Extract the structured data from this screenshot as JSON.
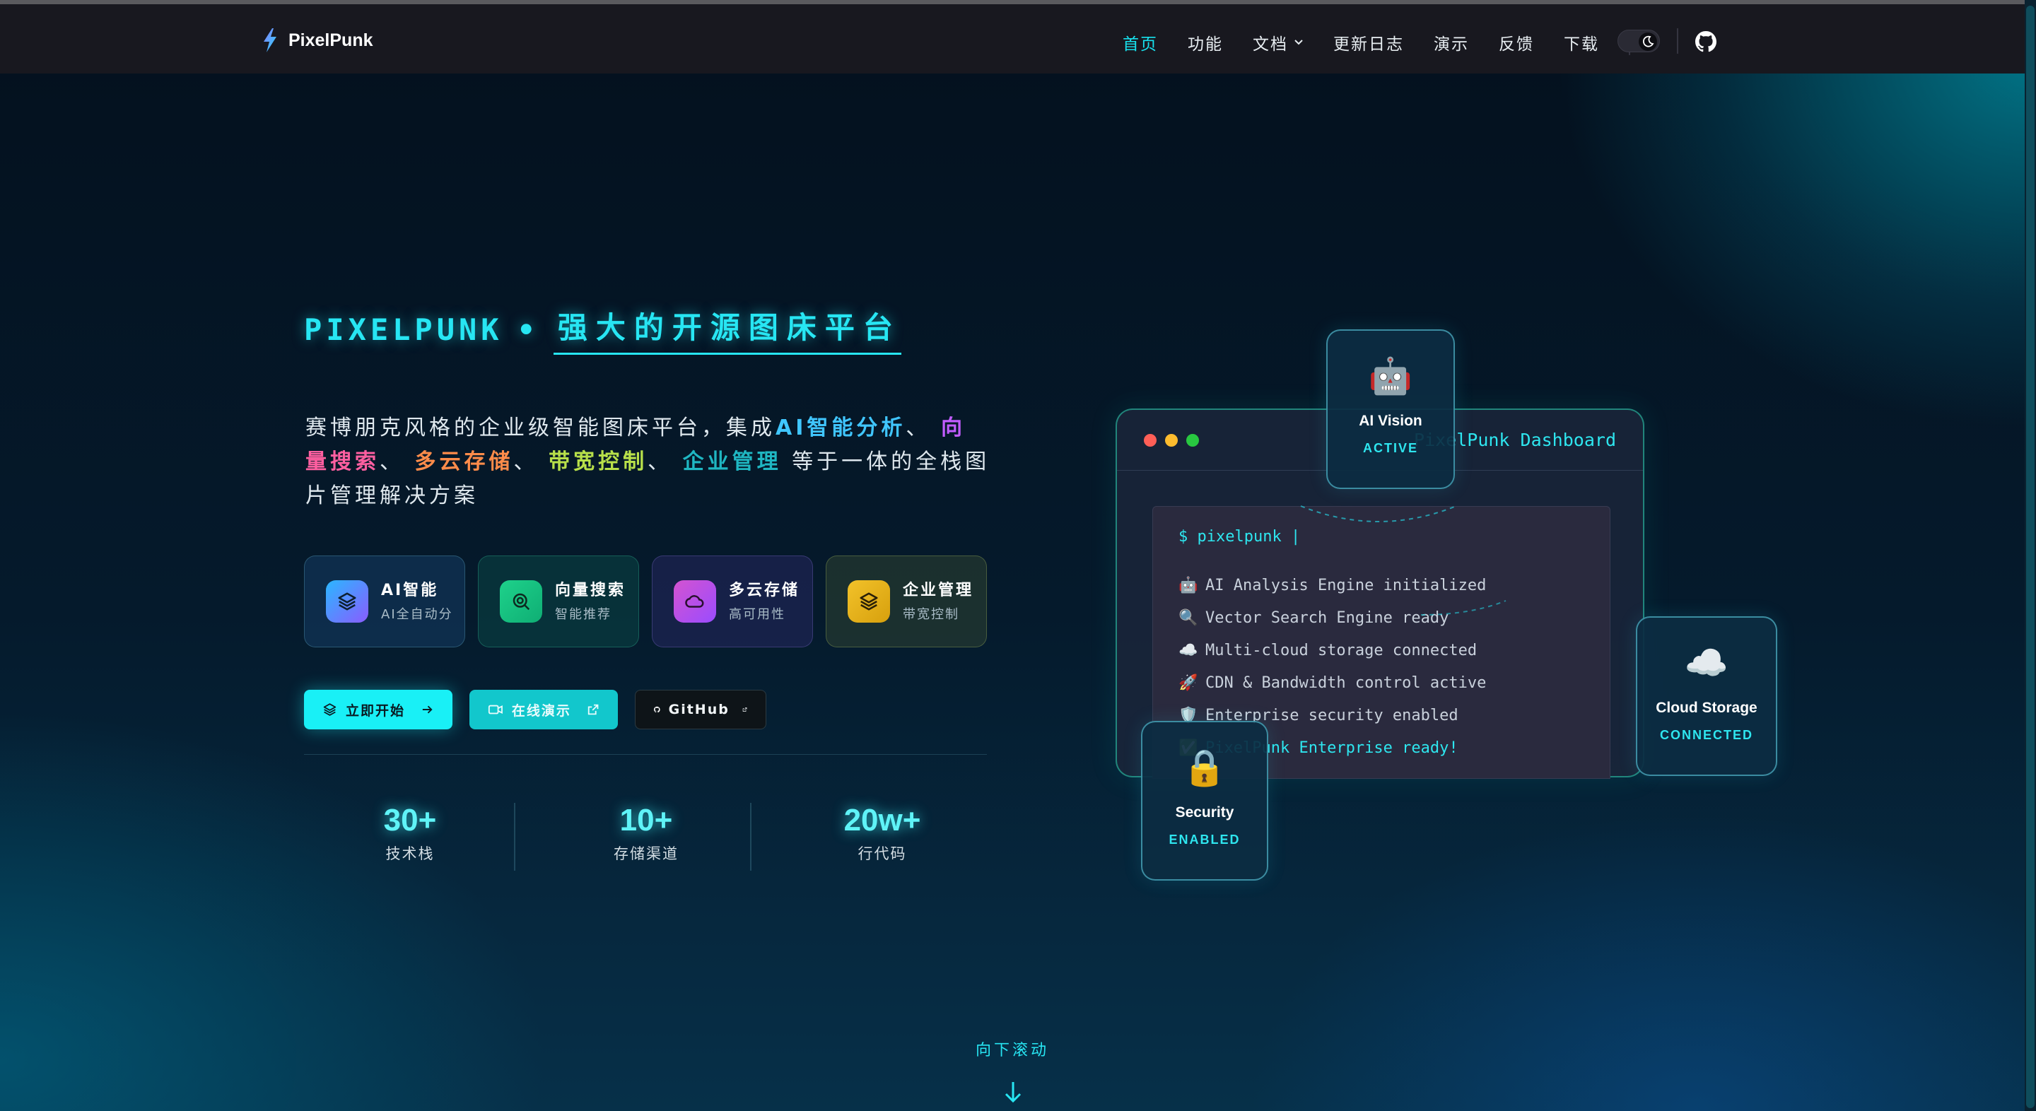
{
  "brand": {
    "name": "PixelPunk"
  },
  "nav": {
    "items": [
      {
        "label": "首页"
      },
      {
        "label": "功能"
      },
      {
        "label": "文档"
      },
      {
        "label": "更新日志"
      },
      {
        "label": "演示"
      },
      {
        "label": "反馈"
      },
      {
        "label": "下载"
      }
    ]
  },
  "hero": {
    "title_a": "PIXELPUNK",
    "title_dot": "•",
    "title_b": "强大的开源图床平台",
    "desc": {
      "p1": "赛博朋克风格的企业级智能图床平台，集成",
      "ai": "AI智能分析",
      "sep": "、",
      "vec_a": "向",
      "vec_b": "量搜索",
      "cloud": "多云存储",
      "band": "带宽控制",
      "ent": "企业管理",
      "p2": "等于一体的全栈图片管理解决方案"
    },
    "features": [
      {
        "title": "AI智能",
        "sub": "AI全自动分析",
        "icon": "layers-icon"
      },
      {
        "title": "向量搜索",
        "sub": "智能推荐",
        "icon": "search-icon"
      },
      {
        "title": "多云存储",
        "sub": "高可用性",
        "icon": "cloud-icon"
      },
      {
        "title": "企业管理",
        "sub": "带宽控制",
        "icon": "layers-icon"
      }
    ],
    "buttons": {
      "start": "立即开始",
      "demo": "在线演示",
      "github": "GitHub"
    },
    "stats": [
      {
        "value": "30+",
        "label": "技术栈"
      },
      {
        "value": "10+",
        "label": "存储渠道"
      },
      {
        "value": "20w+",
        "label": "行代码"
      }
    ],
    "scroll_hint": "向下滚动"
  },
  "dashboard": {
    "title": "PixelPunk Dashboard",
    "prompt": "$ pixelpunk |",
    "lines": [
      {
        "icon": "🤖",
        "text": "AI Analysis Engine initialized"
      },
      {
        "icon": "🔍",
        "text": "Vector Search Engine ready"
      },
      {
        "icon": "☁️",
        "text": "Multi-cloud storage connected"
      },
      {
        "icon": "🚀",
        "text": "CDN & Bandwidth control active"
      },
      {
        "icon": "🛡️",
        "text": "Enterprise security enabled"
      },
      {
        "icon": "✅",
        "text": "PixelPunk Enterprise ready!"
      }
    ],
    "cards": {
      "ai": {
        "emoji": "🤖",
        "title": "AI Vision",
        "status": "ACTIVE"
      },
      "cloud": {
        "emoji": "☁️",
        "title": "Cloud Storage",
        "status": "CONNECTED"
      },
      "security": {
        "emoji": "🔒",
        "title": "Security",
        "status": "ENABLED"
      }
    }
  },
  "colors": {
    "accent": "#27e6f3",
    "nav_bg": "#18181f"
  }
}
